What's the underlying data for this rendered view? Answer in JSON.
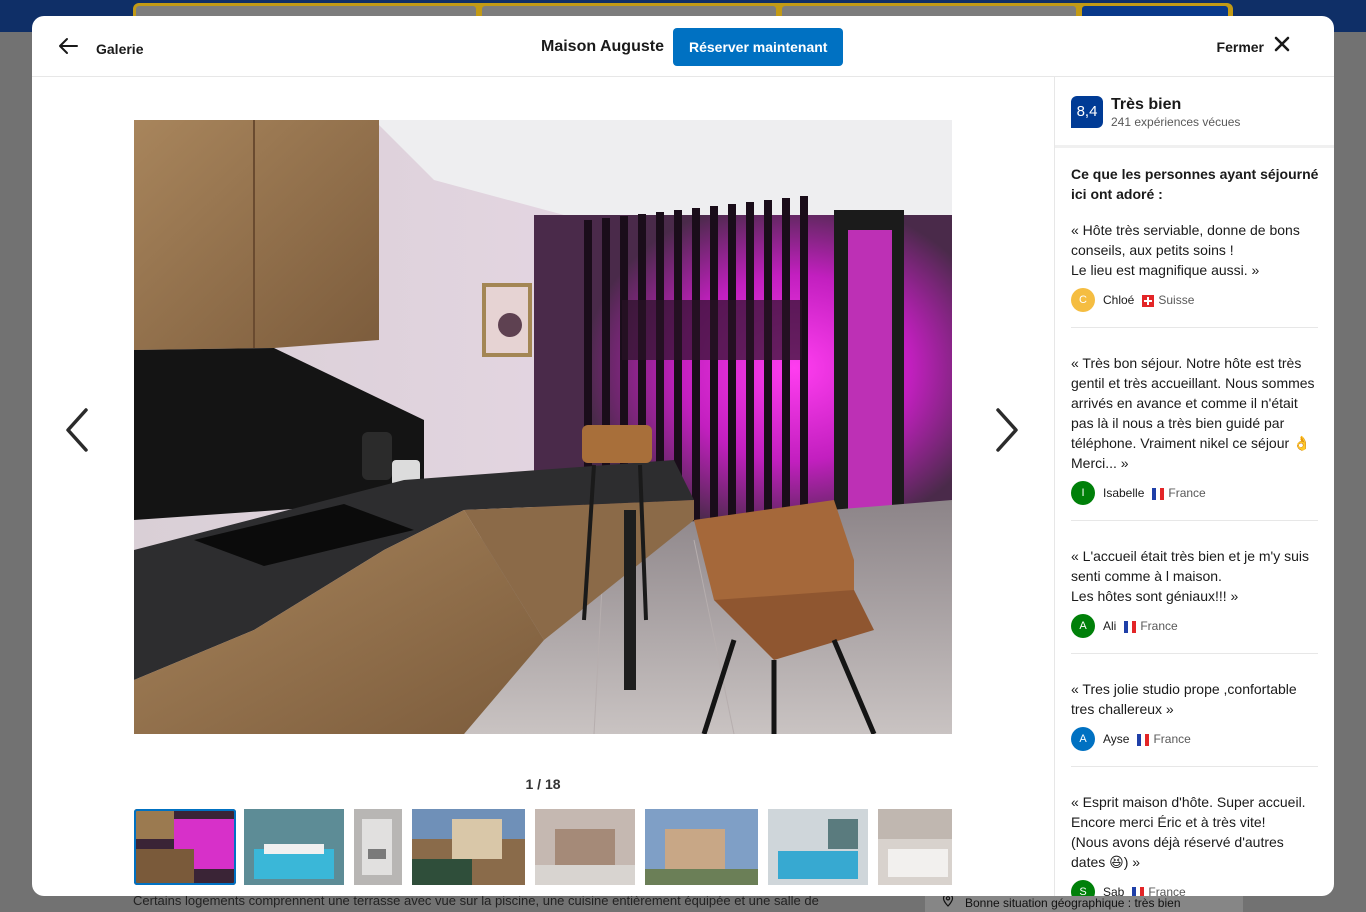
{
  "background": {
    "description_text": "Certains logements comprennent une terrasse avec vue sur la piscine, une cuisine entièrement équipée et une salle de",
    "location_label": "Bonne situation géographique : très bien"
  },
  "header": {
    "back_label": "Galerie",
    "hotel_name": "Maison Auguste",
    "reserve_label": "Réserver maintenant",
    "close_label": "Fermer"
  },
  "gallery": {
    "counter": "1 / 18",
    "current_index": 1,
    "total": 18,
    "thumbnail_count_visible": 8
  },
  "rating": {
    "score": "8,4",
    "word": "Très bien",
    "experiences": "241 expériences vécues"
  },
  "reviews_title": "Ce que les personnes ayant séjourné ici ont adoré :",
  "reviews": [
    {
      "text": "« Hôte très serviable, donne de bons conseils, aux petits soins !\nLe lieu est magnifique aussi. »",
      "initial": "C",
      "name": "Chloé",
      "country": "Suisse",
      "avatar_color": "#f5bd41"
    },
    {
      "text": "« Très bon séjour. Notre hôte est très gentil et très accueillant. Nous sommes arrivés en avance et comme il n'était pas là il nous a très bien guidé par téléphone. Vraiment nikel ce séjour 👌 Merci... »",
      "initial": "I",
      "name": "Isabelle",
      "country": "France",
      "avatar_color": "#008009"
    },
    {
      "text": "« L'accueil était très bien et je m'y suis senti comme à l maison.\nLes hôtes sont géniaux!!! »",
      "initial": "A",
      "name": "Ali",
      "country": "France",
      "avatar_color": "#008009"
    },
    {
      "text": "« Tres jolie studio prope ,confortable tres challereux »",
      "initial": "A",
      "name": "Ayse",
      "country": "France",
      "avatar_color": "#0071c2"
    },
    {
      "text": "« Esprit maison d'hôte. Super accueil. Encore merci Éric et à très vite!\n(Nous avons déjà réservé d'autres dates 😆) »",
      "initial": "S",
      "name": "Sab",
      "country": "France",
      "avatar_color": "#008009"
    }
  ],
  "colors": {
    "accent": "#0071c2",
    "score_badge": "#003b95",
    "background_overlay": "#727272"
  }
}
